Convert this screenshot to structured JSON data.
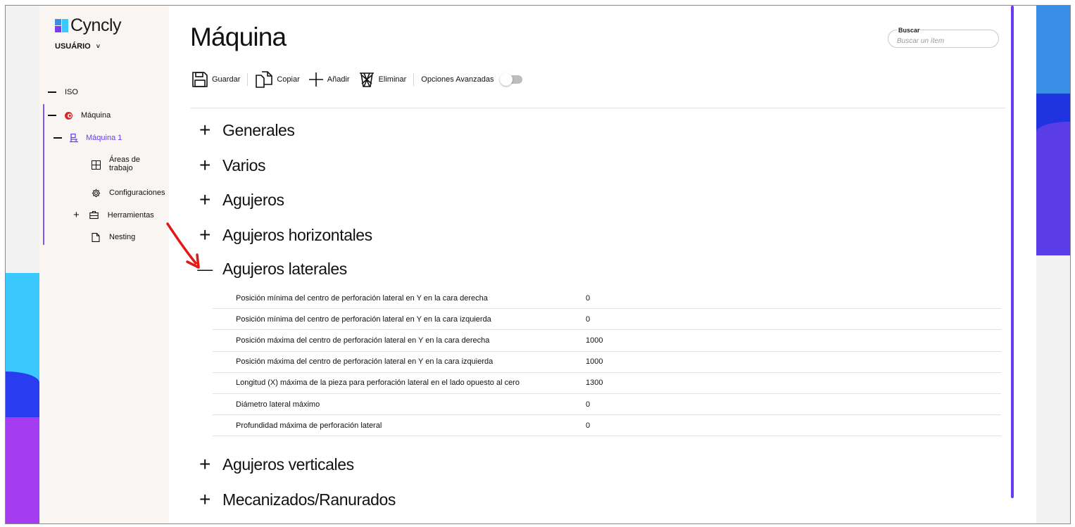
{
  "brand": {
    "name": "Cyncly",
    "colors": {
      "accent": "#6a3cf0",
      "logo_blue": "#3a8ee6",
      "logo_cyan": "#3ac8ff",
      "logo_purple": "#7a3cf0"
    }
  },
  "user": {
    "label": "USUÁRIO",
    "caret": "˅"
  },
  "tree": {
    "iso": {
      "label": "ISO"
    },
    "maquina": {
      "label": "Máquina"
    },
    "maquina1": {
      "label": "Máquina 1"
    },
    "areas": {
      "label_line1": "Áreas de",
      "label_line2": "trabajo"
    },
    "configuraciones": {
      "label": "Configuraciones"
    },
    "herramientas": {
      "label": "Herramientas"
    },
    "nesting": {
      "label": "Nesting"
    }
  },
  "page": {
    "title": "Máquina"
  },
  "search": {
    "label": "Buscar",
    "placeholder": "Buscar un ítem",
    "value": ""
  },
  "toolbar": {
    "save": "Guardar",
    "copy": "Copiar",
    "add": "Añadir",
    "delete": "Eliminar",
    "advanced": "Opciones Avanzadas",
    "advanced_enabled": false
  },
  "sections": [
    {
      "label": "Generales",
      "expanded": false
    },
    {
      "label": "Varios",
      "expanded": false
    },
    {
      "label": "Agujeros",
      "expanded": false
    },
    {
      "label": "Agujeros horizontales",
      "expanded": false
    },
    {
      "label": "Agujeros laterales",
      "expanded": true
    },
    {
      "label": "Agujeros verticales",
      "expanded": false
    },
    {
      "label": "Mecanizados/Ranurados",
      "expanded": false
    }
  ],
  "lateral_properties": [
    {
      "name": "Posición mínima del centro de perforación lateral en Y en la cara derecha",
      "value": "0"
    },
    {
      "name": "Posición mínima del centro de perforación lateral en Y en la cara izquierda",
      "value": "0"
    },
    {
      "name": "Posición máxima del centro de perforación lateral en Y en la cara derecha",
      "value": "1000"
    },
    {
      "name": "Posición máxima del centro de perforación lateral en Y en la cara izquierda",
      "value": "1000"
    },
    {
      "name": "Longitud (X) máxima de la pieza para perforación lateral en el lado opuesto al cero",
      "value": "1300"
    },
    {
      "name": "Diámetro lateral máximo",
      "value": "0"
    },
    {
      "name": "Profundidad máxima de perforación lateral",
      "value": "0"
    }
  ],
  "symbols": {
    "plus": "+",
    "minus": "—"
  }
}
